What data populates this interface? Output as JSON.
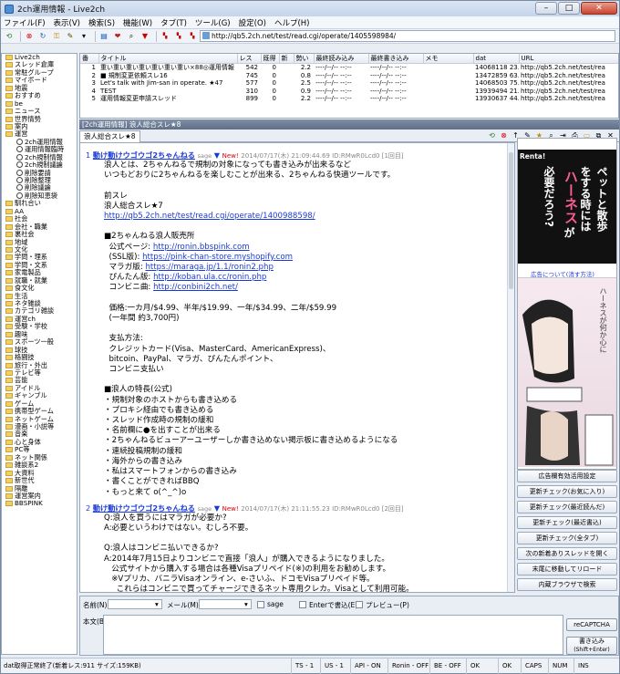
{
  "window": {
    "title": "2ch運用情報 - Live2ch"
  },
  "menu": [
    "ファイル(F)",
    "表示(V)",
    "検索(S)",
    "機能(W)",
    "タブ(T)",
    "ツール(G)",
    "設定(O)",
    "ヘルプ(H)"
  ],
  "address": {
    "url": "http://qb5.2ch.net/test/read.cgi/operate/1405598984/"
  },
  "tree": {
    "items": [
      {
        "label": "Live2ch",
        "level": 0
      },
      {
        "label": "スレッド倉庫",
        "level": 0
      },
      {
        "label": "常駐グループ",
        "level": 0
      },
      {
        "label": "マイボード",
        "level": 0
      },
      {
        "label": "地震",
        "level": 0
      },
      {
        "label": "おすすめ",
        "level": 0
      },
      {
        "label": "be",
        "level": 0
      },
      {
        "label": "ニュース",
        "level": 0
      },
      {
        "label": "世界情勢",
        "level": 0
      },
      {
        "label": "案内",
        "level": 0
      },
      {
        "label": "運営",
        "level": 0
      },
      {
        "label": "2ch運用情報",
        "level": 1
      },
      {
        "label": "運用情報臨時",
        "level": 1
      },
      {
        "label": "2ch規制情報",
        "level": 1
      },
      {
        "label": "2ch規制議論",
        "level": 1
      },
      {
        "label": "削除要請",
        "level": 1
      },
      {
        "label": "削除整理",
        "level": 1
      },
      {
        "label": "削除議論",
        "level": 1
      },
      {
        "label": "削除知恵袋",
        "level": 1
      },
      {
        "label": "馴れ合い",
        "level": 0
      },
      {
        "label": "AA",
        "level": 0
      },
      {
        "label": "社会",
        "level": 0
      },
      {
        "label": "会社・職業",
        "level": 0
      },
      {
        "label": "裏社会",
        "level": 0
      },
      {
        "label": "地域",
        "level": 0
      },
      {
        "label": "文化",
        "level": 0
      },
      {
        "label": "学問・理系",
        "level": 0
      },
      {
        "label": "学問・文系",
        "level": 0
      },
      {
        "label": "家電製品",
        "level": 0
      },
      {
        "label": "就職・就業",
        "level": 0
      },
      {
        "label": "食文化",
        "level": 0
      },
      {
        "label": "生活",
        "level": 0
      },
      {
        "label": "ネタ雑談",
        "level": 0
      },
      {
        "label": "カテゴリ雑談",
        "level": 0
      },
      {
        "label": "運営ch",
        "level": 0
      },
      {
        "label": "受験・学校",
        "level": 0
      },
      {
        "label": "趣味",
        "level": 0
      },
      {
        "label": "スポーツ一般",
        "level": 0
      },
      {
        "label": "球技",
        "level": 0
      },
      {
        "label": "格闘技",
        "level": 0
      },
      {
        "label": "旅行・外出",
        "level": 0
      },
      {
        "label": "テレビ等",
        "level": 0
      },
      {
        "label": "芸能",
        "level": 0
      },
      {
        "label": "アイドル",
        "level": 0
      },
      {
        "label": "ギャンブル",
        "level": 0
      },
      {
        "label": "ゲーム",
        "level": 0
      },
      {
        "label": "携帯型ゲーム",
        "level": 0
      },
      {
        "label": "ネットゲーム",
        "level": 0
      },
      {
        "label": "漫画・小説等",
        "level": 0
      },
      {
        "label": "音楽",
        "level": 0
      },
      {
        "label": "心と身体",
        "level": 0
      },
      {
        "label": "PC等",
        "level": 0
      },
      {
        "label": "ネット関係",
        "level": 0
      },
      {
        "label": "雑談系2",
        "level": 0
      },
      {
        "label": "大資料",
        "level": 0
      },
      {
        "label": "新世代",
        "level": 0
      },
      {
        "label": "隔離",
        "level": 0
      },
      {
        "label": "運営案内",
        "level": 0
      },
      {
        "label": "BBSPINK",
        "level": 0
      }
    ]
  },
  "threadlist": {
    "headers": [
      "番",
      "タイトル",
      "レス",
      "既得",
      "新",
      "勢い",
      "最終読み込み",
      "最終書き込み",
      "メモ",
      "dat",
      "URL"
    ],
    "rows": [
      [
        "1",
        "重い重い重い重い重い重い重い×88◎運用情報",
        "542",
        "0",
        "",
        "2.2",
        "----/--/-- --:--",
        "----/--/-- --:--",
        "",
        "14068118 23...",
        "http://qb5.2ch.net/test/rea"
      ],
      [
        "2",
        "■ 規制変更依頼スレ16",
        "745",
        "0",
        "",
        "0.8",
        "----/--/-- --:--",
        "----/--/-- --:--",
        "",
        "13472859 63...",
        "http://qb5.2ch.net/test/rea"
      ],
      [
        "3",
        "Let's talk with Jim-san in operate. ★47",
        "577",
        "0",
        "",
        "2.5",
        "----/--/-- --:--",
        "----/--/-- --:--",
        "",
        "14068503 75...",
        "http://qb5.2ch.net/test/rea"
      ],
      [
        "4",
        "TEST",
        "310",
        "0",
        "",
        "0.9",
        "----/--/-- --:--",
        "----/--/-- --:--",
        "",
        "13939494 21...",
        "http://qb5.2ch.net/test/rea"
      ],
      [
        "5",
        "運用情報変更申請スレッド",
        "899",
        "0",
        "",
        "2.2",
        "----/--/-- --:--",
        "----/--/-- --:--",
        "",
        "13930637 44...",
        "http://qb5.2ch.net/test/rea"
      ]
    ]
  },
  "viewer": {
    "header": "[2ch運用情報] 浪人総合スレ★8",
    "tab": "浪人総合スレ★8",
    "posts": [
      {
        "num": "1",
        "name": "動け動けウゴウゴ2ちゃんねる",
        "sage": "sage",
        "tri": "▼",
        "new": "New!",
        "date": "2014/07/17(木) 21:09:44.69 ID:RMwR0Lcd0 [1回目]",
        "body": "浪人とは、2ちゃんねるで規制の対象になっても書き込みが出来るなど\nいつもどおりに2ちゃんねるを楽しむことが出来る、2ちゃんねる快適ツールです。\n\n前スレ\n浪人総合スレ★7\n@@http://qb5.2ch.net/test/read.cgi/operate/1400988598/\n\n■2ちゃんねる浪人販売所\n  公式ページ: @@http://ronin.bbspink.com\n  (SSL版): @@https://pink-chan-store.myshopify.com\n  マラガ版: @@https://maraga.jp/1.1/ronin2.php\n  ぴんたん版: @@http://koban.ula.cc/ronin.php\n  コンビニ曲: @@http://conbini2ch.net/\n\n  価格:一カ月/$4.99、半年/$19.99、一年/$34.99、二年/$59.99\n  (一年間 約3,700円)\n\n  支払方法:\n  クレジットカード(Visa、MasterCard、AmericanExpress)、\n  bitcoin、PayPal、マラガ、ぴんたんポイント、\n  コンビニ支払い\n\n■浪人の特長(公式)\n・規制対象のホストからも書き込める\n・プロキシ経由でも書き込める\n・スレッド作成時の規制の緩和\n・名前欄に●を出すことが出来る\n・2ちゃんねるビューアーユーザーしか書き込めない掲示板に書き込めるようになる\n・連続投稿規制の緩和\n・海外からの書き込み\n・私はスマートフォンからの書き込み\n・書くことができればBBQ\n・もっと来て o(^_^)o"
      },
      {
        "num": "2",
        "name": "動け動けウゴウゴ2ちゃんねる",
        "sage": "sage",
        "tri": "▼",
        "new": "New!",
        "date": "2014/07/17(木) 21:11:55.23 ID:RMwR0Lcd0 [2回目]",
        "body": "Q:浪人を買うにはマラガが必要か?\nA:必要というわけではない。むしろ不要。\n\nQ:浪人はコンビニ払いできるか?\nA:2014年7月15日よりコンビニで直接「浪人」が購入できるようになりました。\n   公式サイトから購入する場合は各種Visaプリペイド(※)の利用をお勧めします。\n   ※Vプリカ、バニラVisaオンライン、e-さいふ、ドコモVisaプリペイド等。\n     これらはコンビニで買ってチャージできるネット専用クレカ。Visaとして利用可能。"
      }
    ]
  },
  "ad": {
    "link": "広告について(消す方法)",
    "brand": "Renta!",
    "line1": "ペットと散歩",
    "line2": "をする時には",
    "line3": "ハーネス",
    "line4": "が",
    "line5": "必要だろう?",
    "sub": "ハーネスが何か心に"
  },
  "sidebuttons": [
    "広告欄有効活用設定",
    "更新チェック(お気に入り)",
    "更新チェック(最近読んだ)",
    "更新チェック(最近書込)",
    "更新チェック(全タブ)",
    "次の新着ありスレッドを開く",
    "末尾に移動してリロード",
    "内蔵ブラウザで検索"
  ],
  "compose": {
    "name_label": "名前(N)",
    "mail_label": "メール(M)",
    "sage_label": "sage",
    "enter_label": "Enterで書込(E)",
    "preview_label": "プレビュー(P)",
    "body_label": "本文(B)",
    "captcha_btn": "reCAPTCHA",
    "submit_btn": "書き込み",
    "submit_sub": "(Shift+Enter)"
  },
  "status": {
    "left": "dat取得正常終了(新着レス:911 サイズ:159KB)",
    "ts": "TS - 1",
    "us": "US - 1",
    "api": "API - ON",
    "ronin": "Ronin - OFF",
    "be": "BE - OFF",
    "ok1": "OK",
    "ok2": "OK",
    "caps": "CAPS",
    "num": "NUM",
    "ins": "INS"
  }
}
